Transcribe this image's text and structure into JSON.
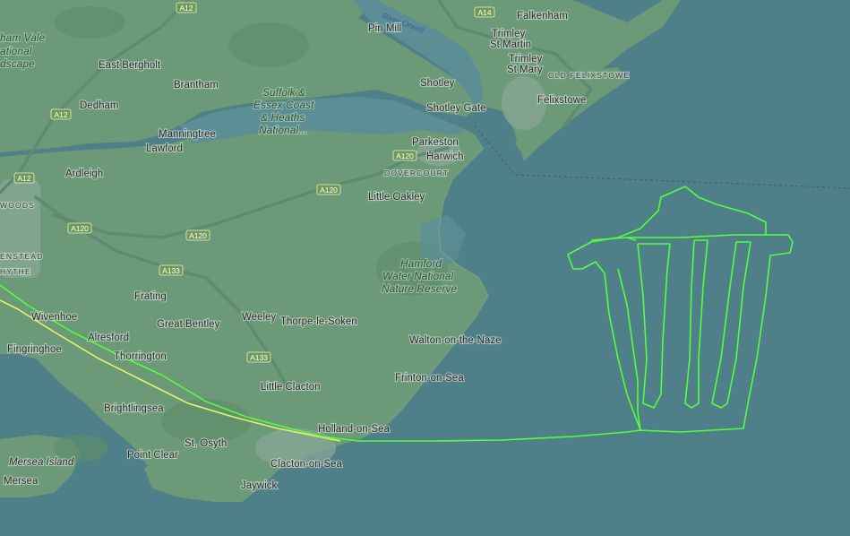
{
  "colors": {
    "sea": "#4f7f88",
    "land": "#6c9a78",
    "flight_track": "#55ff3a",
    "flight_track_secondary": "#e6f26a",
    "road_shield": "#6f9a56"
  },
  "places": [
    {
      "id": "falkenham",
      "text": "Falkenham"
    },
    {
      "id": "pin-mill",
      "text": "Pin Mill"
    },
    {
      "id": "trimley-st-martin-1",
      "text": "Trimley"
    },
    {
      "id": "trimley-st-martin-2",
      "text": "St Martin"
    },
    {
      "id": "trimley-st-mary-1",
      "text": "Trimley"
    },
    {
      "id": "trimley-st-mary-2",
      "text": "St Mary"
    },
    {
      "id": "old-felixstowe",
      "text": "OLD FELIXSTOWE"
    },
    {
      "id": "east-bergholt",
      "text": "East Bergholt"
    },
    {
      "id": "brantham",
      "text": "Brantham"
    },
    {
      "id": "shotley",
      "text": "Shotley"
    },
    {
      "id": "felixstowe",
      "text": "Felixstowe"
    },
    {
      "id": "dedham",
      "text": "Dedham"
    },
    {
      "id": "shotley-gate",
      "text": "Shotley Gate"
    },
    {
      "id": "manningtree",
      "text": "Manningtree"
    },
    {
      "id": "lawford",
      "text": "Lawford"
    },
    {
      "id": "parkeston",
      "text": "Parkeston"
    },
    {
      "id": "harwich",
      "text": "Harwich"
    },
    {
      "id": "dovercourt",
      "text": "DOVERCOURT"
    },
    {
      "id": "ardleigh",
      "text": "Ardleigh"
    },
    {
      "id": "woods",
      "text": "WOODS"
    },
    {
      "id": "little-oakley",
      "text": "Little Oakley"
    },
    {
      "id": "greenstead",
      "text": "ENSTEAD"
    },
    {
      "id": "hythe",
      "text": "HYTHE"
    },
    {
      "id": "frating",
      "text": "Frating"
    },
    {
      "id": "wivenhoe",
      "text": "Wivenhoe"
    },
    {
      "id": "great-bentley",
      "text": "Great Bentley"
    },
    {
      "id": "weeley",
      "text": "Weeley"
    },
    {
      "id": "thorpe-le-soken",
      "text": "Thorpe-le-Soken"
    },
    {
      "id": "alresford",
      "text": "Alresford"
    },
    {
      "id": "fingringhoe",
      "text": "Fingringhoe"
    },
    {
      "id": "thorrington",
      "text": "Thorrington"
    },
    {
      "id": "walton-on-the-naze",
      "text": "Walton-on-the-Naze"
    },
    {
      "id": "little-clacton",
      "text": "Little Clacton"
    },
    {
      "id": "frinton-on-sea",
      "text": "Frinton-on-Sea"
    },
    {
      "id": "brightlingsea",
      "text": "Brightlingsea"
    },
    {
      "id": "holland-on-sea",
      "text": "Holland-on-Sea"
    },
    {
      "id": "st-osyth",
      "text": "St. Osyth"
    },
    {
      "id": "point-clear",
      "text": "Point Clear"
    },
    {
      "id": "mersea-island",
      "text": "Mersea Island"
    },
    {
      "id": "clacton-on-sea",
      "text": "Clacton-on-Sea"
    },
    {
      "id": "mersea",
      "text": "Mersea"
    },
    {
      "id": "jaywick",
      "text": "Jaywick"
    }
  ],
  "areas": [
    {
      "id": "dedham-vale-1",
      "text": "ham Vale"
    },
    {
      "id": "dedham-vale-2",
      "text": "ational"
    },
    {
      "id": "dedham-vale-3",
      "text": "dscape"
    },
    {
      "id": "suffolk-1",
      "text": "Suffolk &"
    },
    {
      "id": "suffolk-2",
      "text": "Essex Coast"
    },
    {
      "id": "suffolk-3",
      "text": "& Heaths"
    },
    {
      "id": "suffolk-4",
      "text": "National..."
    },
    {
      "id": "hamford-1",
      "text": "Hamford"
    },
    {
      "id": "hamford-2",
      "text": "Water National"
    },
    {
      "id": "hamford-3",
      "text": "Nature Reserve"
    }
  ],
  "water": [
    {
      "id": "river-orwell",
      "text": "River Orwell"
    }
  ],
  "roads": [
    {
      "id": "a12-top",
      "text": "A12"
    },
    {
      "id": "a14",
      "text": "A14"
    },
    {
      "id": "a12-mid",
      "text": "A12"
    },
    {
      "id": "a12-left",
      "text": "A12"
    },
    {
      "id": "a120-harwich",
      "text": "A120"
    },
    {
      "id": "a120-mid",
      "text": "A120"
    },
    {
      "id": "a120-left",
      "text": "A120"
    },
    {
      "id": "a120-lower",
      "text": "A120"
    },
    {
      "id": "a133-top",
      "text": "A133"
    },
    {
      "id": "a133-bottom",
      "text": "A133"
    }
  ]
}
